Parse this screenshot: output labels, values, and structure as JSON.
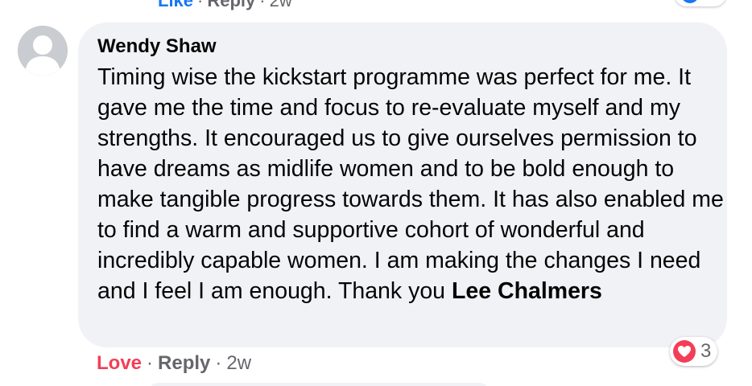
{
  "previous_comment": {
    "like_label": "Like",
    "reply_label": "Reply",
    "separator": "·",
    "timestamp": "2w",
    "reaction_icon": "like-icon"
  },
  "comment": {
    "author": "Wendy Shaw",
    "avatar_icon": "default-avatar-icon",
    "text": "Timing wise the kickstart programme was perfect for me. It gave me the time and focus to re-evaluate myself and my strengths. It encouraged us to give ourselves permission to have dreams as midlife women and to be bold enough to make tangible progress towards them. It has also enabled me to find a warm and supportive cohort of wonderful and incredibly capable women. I am making the changes I need and I feel I am enough. Thank you",
    "mention": "Lee Chalmers",
    "reaction": {
      "icon": "heart-icon",
      "count": "3"
    },
    "actions": {
      "love_label": "Love",
      "reply_label": "Reply",
      "separator": "·",
      "timestamp": "2w"
    }
  },
  "colors": {
    "bubble_bg": "#f0f2f5",
    "love_red": "#f33e58",
    "meta_grey": "#65676b",
    "like_blue": "#1877f2",
    "text": "#050505"
  }
}
